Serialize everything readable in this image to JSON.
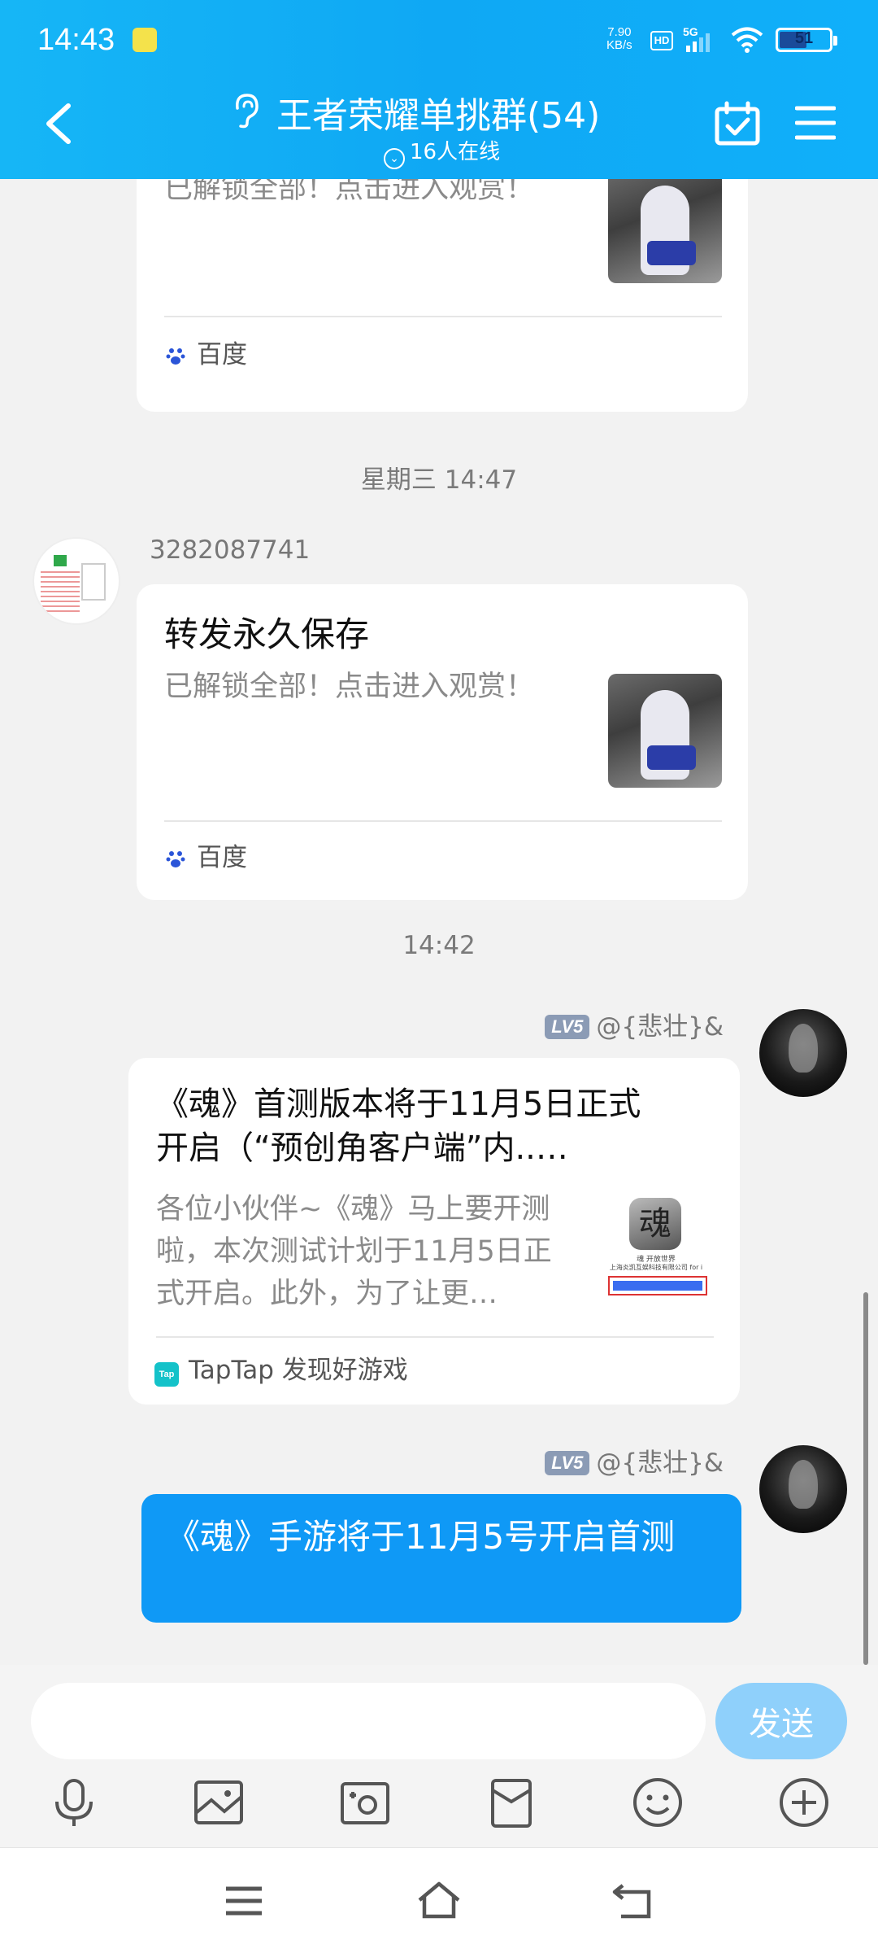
{
  "status_bar": {
    "time": "14:43",
    "net_speed_value": "7.90",
    "net_speed_unit": "KB/s",
    "hd": "HD",
    "network": "5G",
    "battery": "51"
  },
  "header": {
    "title": "王者荣耀单挑群(54)",
    "online": "16人在线"
  },
  "messages": {
    "card1": {
      "desc": "已解锁全部！点击进入观赏！",
      "source": "百度"
    },
    "ts1": "星期三 14:47",
    "msg2": {
      "sender": "3282087741",
      "title": "转发永久保存",
      "desc": "已解锁全部！点击进入观赏！",
      "source": "百度"
    },
    "ts2": "14:42",
    "msg3": {
      "level": "LV5",
      "sender": "@{悲壮}&",
      "title_line1": "《魂》首测版本将于11月5日正式",
      "title_line2": "开启（“预创角客户端”内..…",
      "desc_line1": "各位小伙伴~《魂》马上要开测",
      "desc_line2": "啦，本次测试计划于11月5日正",
      "desc_line3": "式开启。此外，为了让更…",
      "thumb_char": "魂",
      "thumb_caption1": "魂 开放世界",
      "thumb_caption2": "上海炎凯互娱科技有限公司 for i",
      "source_icon": "Tap",
      "source": "TapTap 发现好游戏"
    },
    "msg4": {
      "level": "LV5",
      "sender": "@{悲壮}&",
      "text": "《魂》手游将于11月5号开启首测"
    }
  },
  "input": {
    "placeholder": "",
    "send_label": "发送"
  },
  "colors": {
    "header": "#10aaf5",
    "bubble": "#0f99f6",
    "send_disabled": "#8fd0fb"
  }
}
